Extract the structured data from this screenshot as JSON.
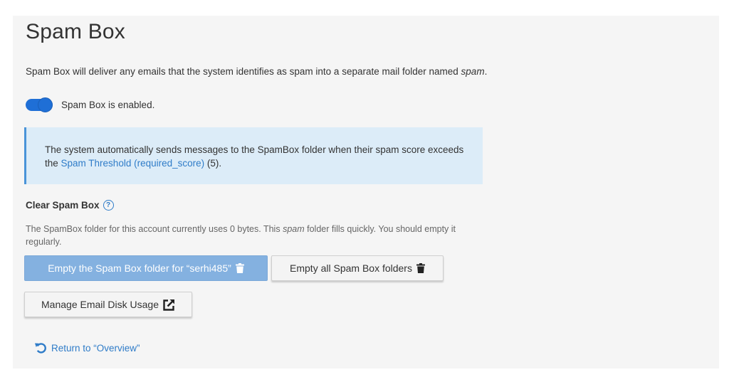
{
  "page": {
    "title": "Spam Box",
    "description_prefix": "Spam Box will deliver any emails that the system identifies as spam into a separate mail folder named ",
    "description_folder": "spam",
    "description_suffix": "."
  },
  "toggle": {
    "enabled": true,
    "label": "Spam Box is enabled."
  },
  "alert": {
    "text_before": "The system automatically sends messages to the SpamBox folder when their spam score exceeds the ",
    "link_text": "Spam Threshold (required_score)",
    "text_after": " (5)."
  },
  "clear_section": {
    "title": "Clear Spam Box",
    "help_icon": "question-circle-icon",
    "usage_prefix": "The SpamBox folder for this account currently uses 0 bytes. This ",
    "usage_folder": "spam",
    "usage_suffix": " folder fills quickly. You should empty it regularly."
  },
  "buttons": {
    "empty_user_label": "Empty the Spam Box folder for “serhi485”",
    "empty_all_label": "Empty all Spam Box folders",
    "manage_label": "Manage Email Disk Usage",
    "trash_icon": "trash-icon",
    "external_icon": "external-link-icon"
  },
  "return_link": {
    "label": "Return to “Overview”",
    "icon": "undo-icon"
  },
  "colors": {
    "accent": "#1f6fd6",
    "link": "#2f7cc8",
    "alert_bg": "#dcecf8",
    "alert_border": "#4a94d8",
    "primary_button": "#84b1e0"
  }
}
